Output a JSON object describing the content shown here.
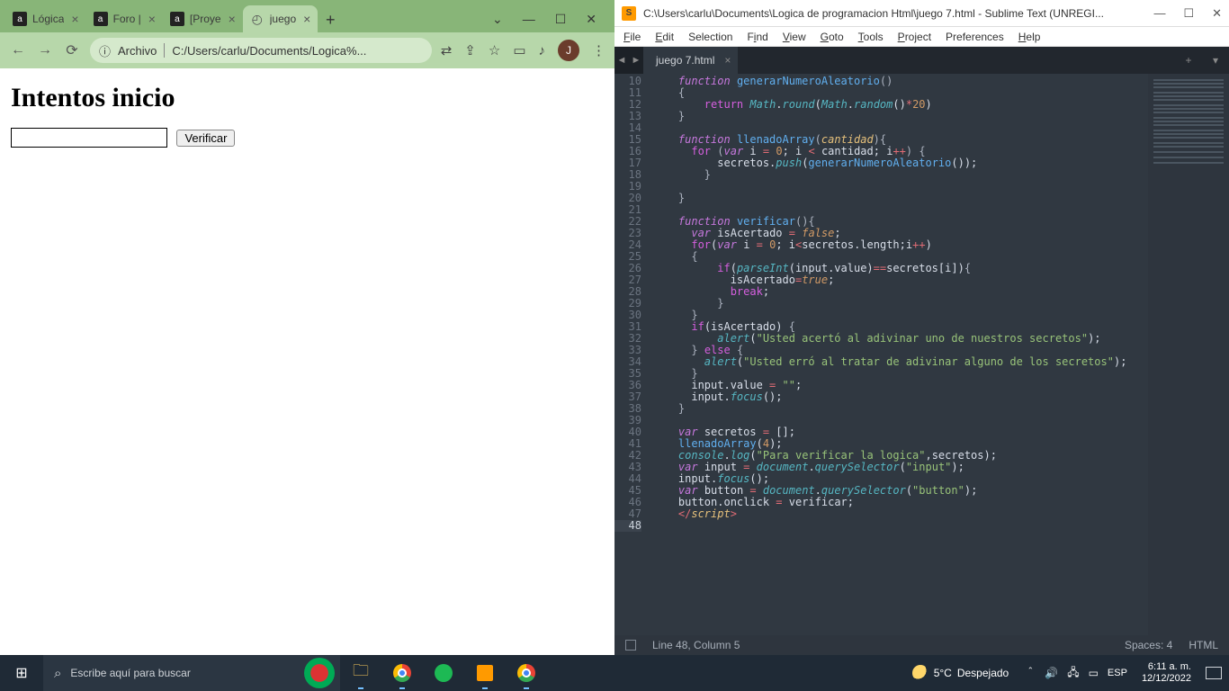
{
  "chrome": {
    "tabs": [
      {
        "title": "Lógica",
        "fav": "a"
      },
      {
        "title": "Foro |",
        "fav": "a"
      },
      {
        "title": "[Proye",
        "fav": "a"
      },
      {
        "title": "juego",
        "fav": "doc",
        "active": true
      }
    ],
    "windowControls": {
      "min": "—",
      "max": "☐",
      "close": "✕",
      "dropdown": "⌄"
    },
    "addr": {
      "back": "←",
      "fwd": "→",
      "reload": "⟳",
      "infoIcon": "ⓘ",
      "label": "Archivo",
      "url": "C:/Users/carlu/Documents/Logica%...",
      "translate": "⇄",
      "share": "⇪",
      "star": "☆",
      "ext": "▭",
      "music": "♪",
      "avatar": "J",
      "kebab": "⋮"
    },
    "page": {
      "heading": "Intentos inicio",
      "button": "Verificar",
      "inputValue": ""
    }
  },
  "sublime": {
    "title": "C:\\Users\\carlu\\Documents\\Logica de programacion Html\\juego 7.html - Sublime Text (UNREGI...",
    "menu": [
      "File",
      "Edit",
      "Selection",
      "Find",
      "View",
      "Goto",
      "Tools",
      "Project",
      "Preferences",
      "Help"
    ],
    "tab": "juego 7.html",
    "status": {
      "pos": "Line 48, Column 5",
      "spaces": "Spaces: 4",
      "lang": "HTML"
    },
    "gutterStart": 10,
    "gutterEnd": 48,
    "currentLine": 48
  },
  "taskbar": {
    "searchPlaceholder": "Escribe aquí para buscar",
    "weather": {
      "temp": "5°C",
      "cond": "Despejado"
    },
    "clock": {
      "time": "6:11 a. m.",
      "date": "12/12/2022"
    }
  }
}
